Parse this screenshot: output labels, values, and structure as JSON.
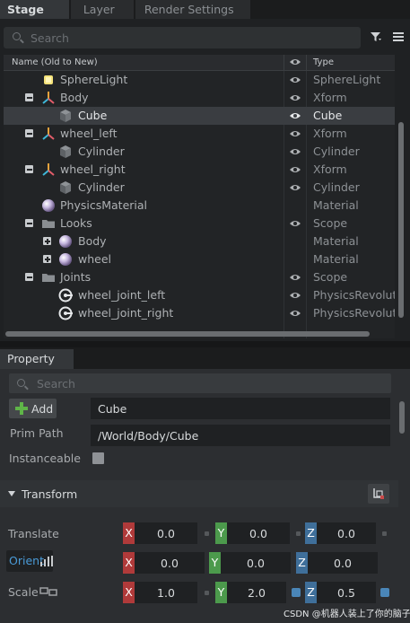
{
  "tabs": [
    "Stage",
    "Layer",
    "Render Settings"
  ],
  "stage": {
    "search_placeholder": "Search",
    "columns": {
      "name": "Name (Old to New)",
      "type": "Type"
    },
    "rows": [
      {
        "name": "SphereLight",
        "type": "SphereLight",
        "icon": "sphere-light-icon"
      },
      {
        "name": "Body",
        "type": "Xform",
        "icon": "xform-icon",
        "expander": "minus"
      },
      {
        "name": "Cube",
        "type": "Cube",
        "icon": "cube-icon",
        "selected": true
      },
      {
        "name": "wheel_left",
        "type": "Xform",
        "icon": "xform-icon",
        "expander": "minus"
      },
      {
        "name": "Cylinder",
        "type": "Cylinder",
        "icon": "cube-icon"
      },
      {
        "name": "wheel_right",
        "type": "Xform",
        "icon": "xform-icon",
        "expander": "minus"
      },
      {
        "name": "Cylinder",
        "type": "Cylinder",
        "icon": "cube-icon"
      },
      {
        "name": "PhysicsMaterial",
        "type": "Material",
        "icon": "material-sphere-icon"
      },
      {
        "name": "Looks",
        "type": "Scope",
        "icon": "folder-icon",
        "expander": "minus"
      },
      {
        "name": "Body",
        "type": "Material",
        "icon": "material-sphere-icon",
        "expander": "plus"
      },
      {
        "name": "wheel",
        "type": "Material",
        "icon": "material-sphere-icon",
        "expander": "plus"
      },
      {
        "name": "Joints",
        "type": "Scope",
        "icon": "folder-icon",
        "expander": "minus"
      },
      {
        "name": "wheel_joint_left",
        "type": "PhysicsRevolute",
        "icon": "revolute-joint-icon"
      },
      {
        "name": "wheel_joint_right",
        "type": "PhysicsRevolute",
        "icon": "revolute-joint-icon"
      }
    ]
  },
  "property": {
    "tab": "Property",
    "search_placeholder": "Search",
    "add_label": "Add",
    "prim_name": "Cube",
    "prim_path_label": "Prim Path",
    "prim_path": "/World/Body/Cube",
    "instanceable_label": "Instanceable",
    "transform_label": "Transform",
    "translate": {
      "label": "Translate",
      "x": "0.0",
      "y": "0.0",
      "z": "0.0"
    },
    "orient": {
      "label": "Orient",
      "x": "0.0",
      "y": "0.0",
      "z": "0.0"
    },
    "scale": {
      "label": "Scale",
      "x": "1.0",
      "y": "2.0",
      "z": "0.5"
    }
  },
  "watermark": "CSDN @机器人装上了你的脑子",
  "colors": {
    "axis_x": "#b03a3a",
    "axis_y": "#4c9a4c",
    "axis_z": "#3f6f9a",
    "selection": "#3a3d41"
  }
}
